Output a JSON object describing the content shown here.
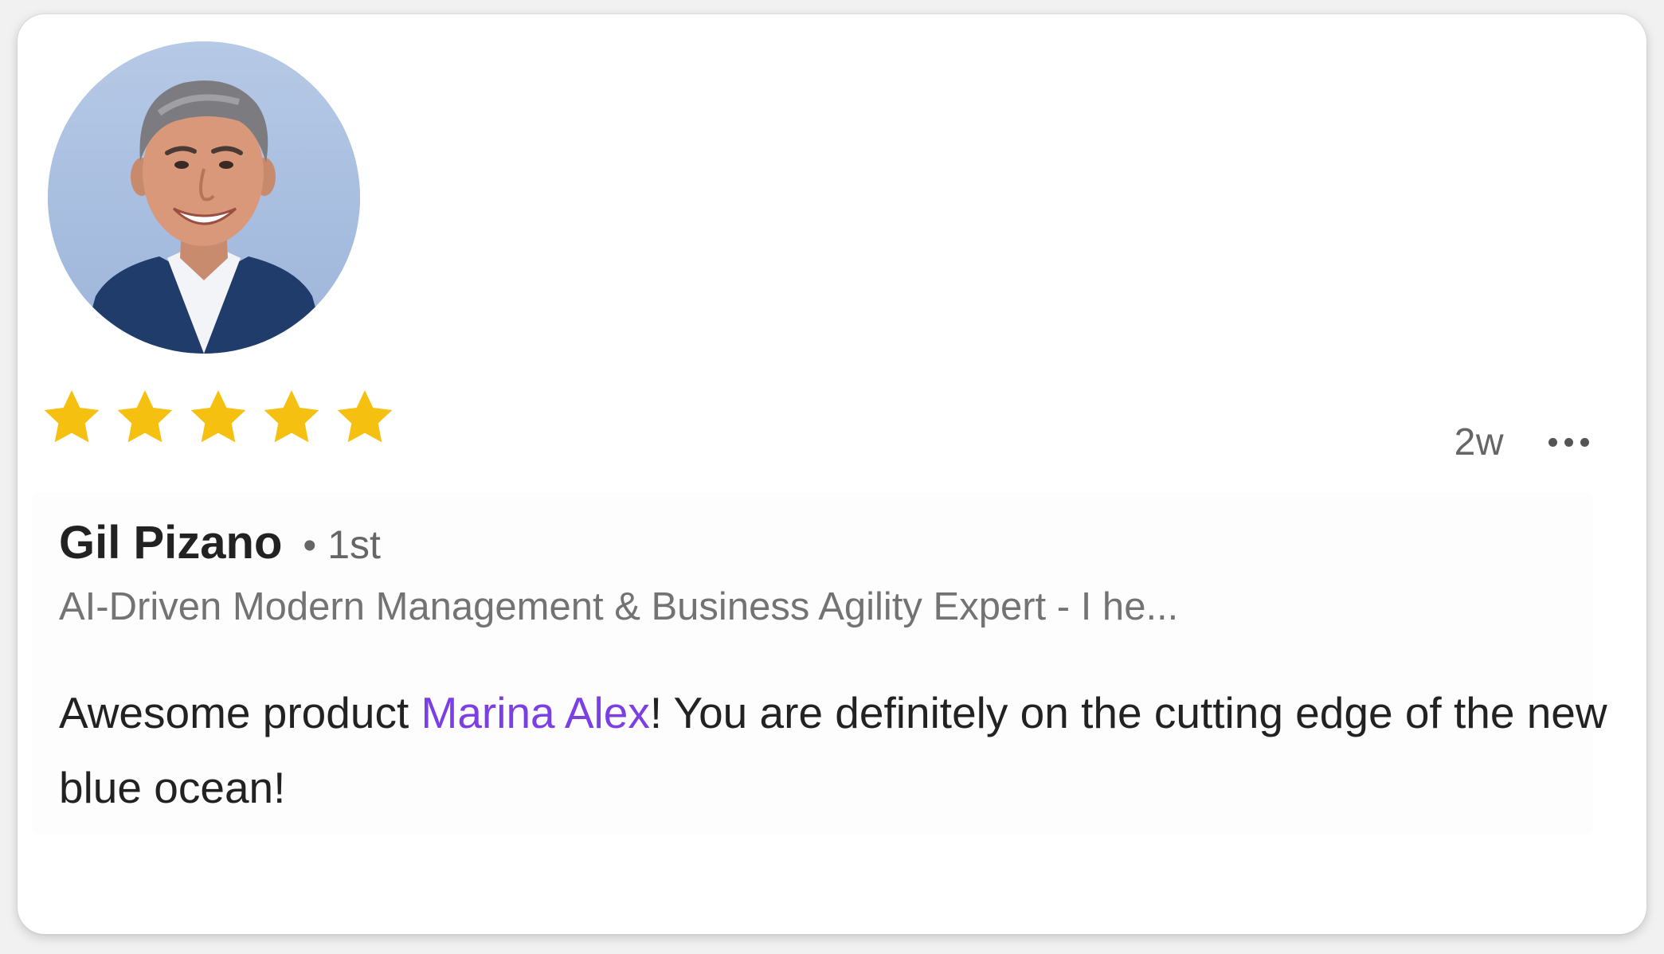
{
  "review": {
    "author_name": "Gil Pizano",
    "degree_separator": "•",
    "degree": "1st",
    "headline": "AI-Driven Modern Management & Business Agility Expert - I he...",
    "time": "2w",
    "rating": 5,
    "rating_max": 5,
    "star_color": "#F5C010",
    "comment": {
      "before_mention": "Awesome product ",
      "mention": "Marina Alex",
      "after_mention": "! You are definitely on the cutting edge of the new blue ocean!"
    },
    "mention_color": "#7B3FE4",
    "icons": {
      "avatar": "profile-photo",
      "star": "star-icon",
      "more": "more-options-icon"
    }
  }
}
